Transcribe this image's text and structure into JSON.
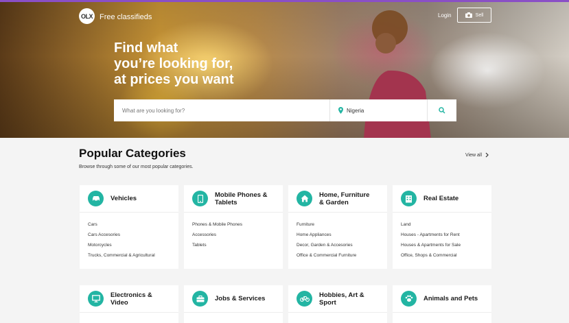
{
  "header": {
    "logo_text": "OLX",
    "tagline": "Free classifieds",
    "login_label": "Login",
    "sell_label": "Sell"
  },
  "hero": {
    "title_lines": [
      "Find what",
      "you’re looking for,",
      "at prices you want"
    ]
  },
  "search": {
    "placeholder": "What are you looking for?",
    "location": "Nigeria"
  },
  "popular": {
    "title": "Popular Categories",
    "subtitle": "Browse through some of our most popular categories.",
    "view_all": "View all"
  },
  "categories": [
    {
      "title_lines": [
        "Vehicles"
      ],
      "icon": "car-icon",
      "items": [
        "Cars",
        "Cars Accesories",
        "Motorcycles",
        "Trucks, Commercial & Agricultural"
      ]
    },
    {
      "title_lines": [
        "Mobile Phones &",
        "Tablets"
      ],
      "icon": "phone-icon",
      "items": [
        "Phones & Mobile Phones",
        "Accessories",
        "Tablets"
      ]
    },
    {
      "title_lines": [
        "Home, Furniture",
        "& Garden"
      ],
      "icon": "home-icon",
      "items": [
        "Furniture",
        "Home Appliances",
        "Decor, Garden & Accesories",
        "Office & Commercial Furniture"
      ]
    },
    {
      "title_lines": [
        "Real Estate"
      ],
      "icon": "building-icon",
      "items": [
        "Land",
        "Houses - Apartments for Rent",
        "Houses & Apartments for Sale",
        "Office, Shops & Commercial"
      ]
    },
    {
      "title_lines": [
        "Electronics &",
        "Video"
      ],
      "icon": "monitor-icon",
      "items": []
    },
    {
      "title_lines": [
        "Jobs & Services"
      ],
      "icon": "briefcase-icon",
      "items": []
    },
    {
      "title_lines": [
        "Hobbies, Art &",
        "Sport"
      ],
      "icon": "bicycle-icon",
      "items": []
    },
    {
      "title_lines": [
        "Animals and Pets"
      ],
      "icon": "paw-icon",
      "items": []
    }
  ],
  "colors": {
    "accent": "#23b5a3",
    "top_line": "#8a4fc6"
  }
}
